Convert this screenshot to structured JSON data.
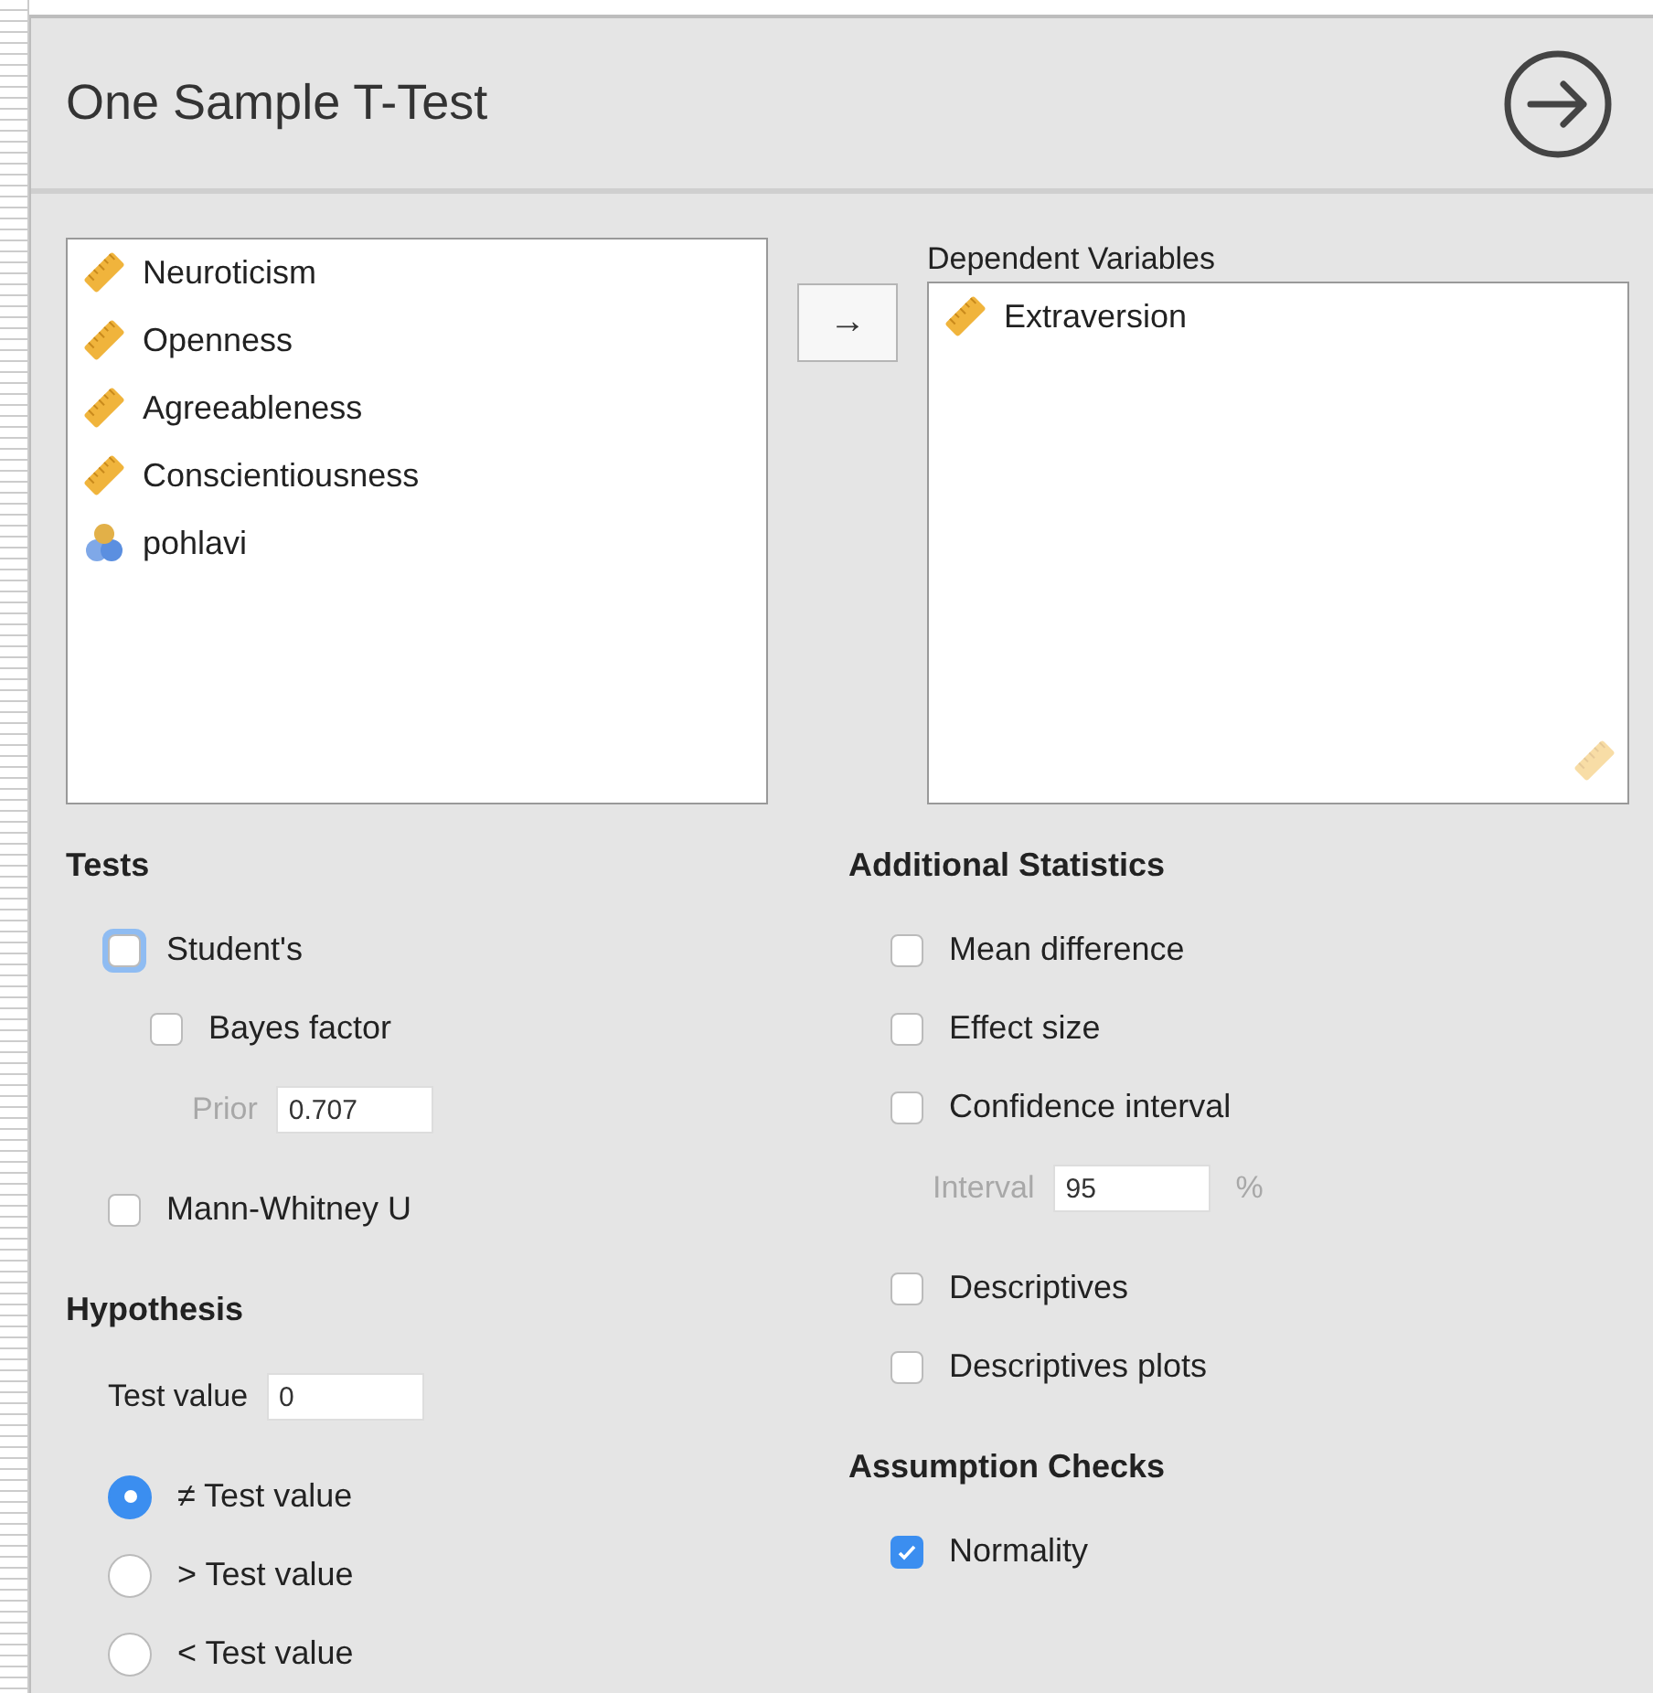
{
  "window": {
    "title": "One Sample T-Test"
  },
  "available_variables": [
    {
      "name": "Neuroticism",
      "kind": "scale"
    },
    {
      "name": "Openness",
      "kind": "scale"
    },
    {
      "name": "Agreeableness",
      "kind": "scale"
    },
    {
      "name": "Conscientiousness",
      "kind": "scale"
    },
    {
      "name": "pohlavi",
      "kind": "nominal"
    }
  ],
  "move_button": {
    "label": "→"
  },
  "dependent_variables": {
    "label": "Dependent Variables",
    "items": [
      {
        "name": "Extraversion",
        "kind": "scale"
      }
    ]
  },
  "left_sections": [
    {
      "title": "Tests",
      "items": [
        {
          "kind": "checkbox",
          "label": "Student's",
          "checked": false,
          "focused": true,
          "children": [
            {
              "kind": "checkbox",
              "label": "Bayes factor",
              "checked": false,
              "focused": false,
              "children": [
                {
                  "kind": "field",
                  "label": "Prior",
                  "value": "0.707",
                  "disabled": true
                }
              ]
            }
          ]
        },
        {
          "kind": "checkbox",
          "label": "Mann-Whitney U",
          "checked": false,
          "focused": false
        }
      ]
    },
    {
      "title": "Hypothesis",
      "items": [
        {
          "kind": "field",
          "label": "Test value",
          "value": "0",
          "disabled": false
        },
        {
          "kind": "radio",
          "label": "≠ Test value",
          "selected": true
        },
        {
          "kind": "radio",
          "label": "> Test value",
          "selected": false
        },
        {
          "kind": "radio",
          "label": "< Test value",
          "selected": false
        }
      ]
    }
  ],
  "right_sections": [
    {
      "title": "Additional Statistics",
      "items": [
        {
          "kind": "checkbox",
          "label": "Mean difference",
          "checked": false,
          "focused": false
        },
        {
          "kind": "checkbox",
          "label": "Effect size",
          "checked": false,
          "focused": false
        },
        {
          "kind": "checkbox",
          "label": "Confidence interval",
          "checked": false,
          "focused": false,
          "children": [
            {
              "kind": "field",
              "label": "Interval",
              "value": "95",
              "unit": "%",
              "disabled": true
            }
          ]
        },
        {
          "kind": "checkbox",
          "label": "Descriptives",
          "checked": false,
          "focused": false
        },
        {
          "kind": "checkbox",
          "label": "Descriptives plots",
          "checked": false,
          "focused": false
        }
      ]
    },
    {
      "title": "Assumption Checks",
      "items": [
        {
          "kind": "checkbox",
          "label": "Normality",
          "checked": true,
          "focused": false
        }
      ]
    }
  ]
}
